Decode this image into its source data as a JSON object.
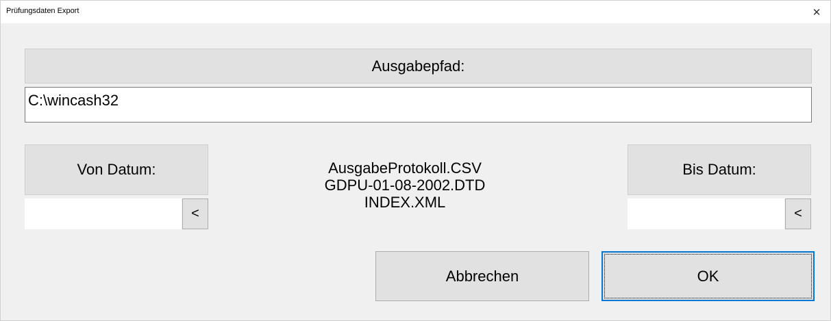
{
  "window": {
    "title": "Prüfungsdaten Export",
    "close_glyph": "✕"
  },
  "output": {
    "label": "Ausgabepfad:",
    "path_value": "C:\\wincash32"
  },
  "from_date": {
    "label": "Von Datum:",
    "value": "",
    "picker_label": "<"
  },
  "to_date": {
    "label": "Bis Datum:",
    "value": "",
    "picker_label": "<"
  },
  "files": {
    "line1": "AusgabeProtokoll.CSV",
    "line2": "GDPU-01-08-2002.DTD",
    "line3": "INDEX.XML"
  },
  "actions": {
    "cancel_label": "Abbrechen",
    "ok_label": "OK"
  }
}
